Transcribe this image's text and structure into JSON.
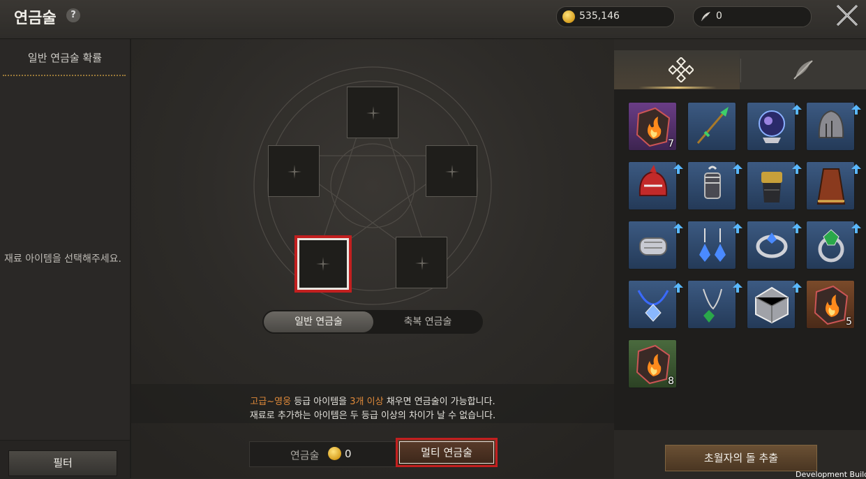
{
  "header": {
    "title": "연금술",
    "help": "?",
    "gold": "535,146",
    "feather": "0"
  },
  "left_panel": {
    "heading": "일반 연금술 확률",
    "message": "재료 아이템을 선택해주세요.",
    "filter_label": "필터"
  },
  "center": {
    "tabs": [
      {
        "label": "일반 연금술",
        "active": true
      },
      {
        "label": "축복 연금술",
        "active": false
      }
    ],
    "info_line1": {
      "a": "고급~영웅",
      "b": " 등급 아이템을 ",
      "c": "3개 이상",
      "d": " 채우면 연금술이 가능합니다."
    },
    "info_line2": "재료로 추가하는 아이템은 두 등급 이상의 차이가 날 수 없습니다.",
    "cost_label": "연금술",
    "cost_value": "0",
    "multi_label": "멀티 연금술"
  },
  "right_panel": {
    "tabs": [
      {
        "icon": "diamond-pattern-icon",
        "active": true
      },
      {
        "icon": "wing-crossed-icon",
        "active": false
      }
    ],
    "items": [
      {
        "icon": "fire-stone-icon",
        "grade": "epic",
        "count": "7",
        "upgrade": false
      },
      {
        "icon": "spear-icon",
        "grade": "rare",
        "count": "",
        "upgrade": false
      },
      {
        "icon": "orb-icon",
        "grade": "rare",
        "count": "",
        "upgrade": true
      },
      {
        "icon": "helmet-icon",
        "grade": "rare",
        "count": "",
        "upgrade": true
      },
      {
        "icon": "red-helmet-icon",
        "grade": "rare",
        "count": "",
        "upgrade": true
      },
      {
        "icon": "gauntlet-icon",
        "grade": "rare",
        "count": "",
        "upgrade": true
      },
      {
        "icon": "glove-icon",
        "grade": "rare",
        "count": "",
        "upgrade": true
      },
      {
        "icon": "cape-icon",
        "grade": "rare",
        "count": "",
        "upgrade": true
      },
      {
        "icon": "bracer-icon",
        "grade": "rare",
        "count": "",
        "upgrade": true
      },
      {
        "icon": "earrings-icon",
        "grade": "rare",
        "count": "",
        "upgrade": true
      },
      {
        "icon": "ring-icon",
        "grade": "rare",
        "count": "",
        "upgrade": true
      },
      {
        "icon": "emerald-ring-icon",
        "grade": "rare",
        "count": "",
        "upgrade": true
      },
      {
        "icon": "necklace-icon",
        "grade": "rare",
        "count": "",
        "upgrade": true
      },
      {
        "icon": "pendant-icon",
        "grade": "rare",
        "count": "",
        "upgrade": true
      },
      {
        "icon": "dice-icon",
        "grade": "rare",
        "count": "",
        "upgrade": true
      },
      {
        "icon": "fire-stone-icon",
        "grade": "legend",
        "count": "5",
        "upgrade": false
      },
      {
        "icon": "fire-stone-icon",
        "grade": "uncommon",
        "count": "8",
        "upgrade": false
      }
    ],
    "extract_label": "초월자의 돌 추출"
  },
  "footer": {
    "dev_build": "Development Build"
  },
  "colors": {
    "accent_red": "#c21f1f",
    "highlight": "#e08a3a",
    "gold": "#d8a020"
  }
}
